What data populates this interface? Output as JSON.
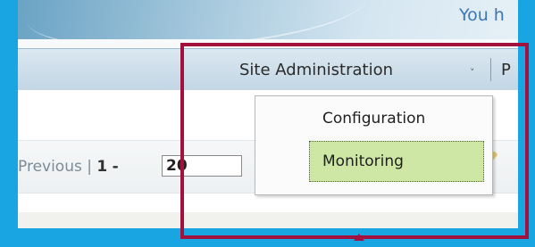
{
  "header": {
    "welcome_text": "You h"
  },
  "nav": {
    "site_admin_label": "Site Administration",
    "chevron_icon": "chevron-down-icon",
    "next_tab_label": "P"
  },
  "menu": {
    "items": [
      {
        "label": "Configuration"
      },
      {
        "label": "Monitoring"
      }
    ]
  },
  "pager": {
    "previous_label": "Previous",
    "separator": "|",
    "range_start": "1",
    "range_dash": "-",
    "page_value": "20"
  },
  "colors": {
    "outer_background": "#18a5e2",
    "highlight_border": "#a3123f",
    "selected_item": "#cfe7a4"
  }
}
